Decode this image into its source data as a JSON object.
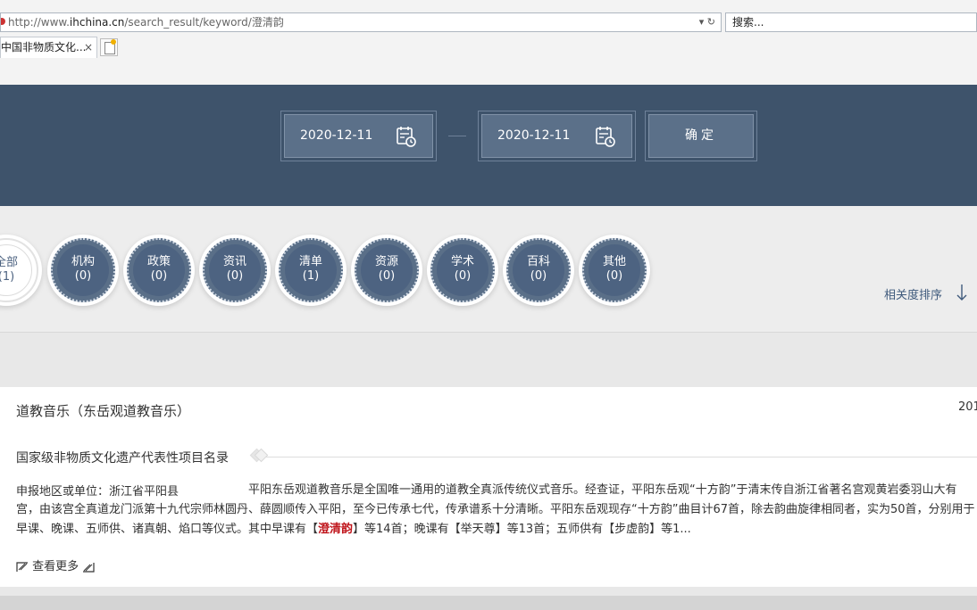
{
  "browser": {
    "url_prefix": "http://www.",
    "url_domain": "ihchina.cn",
    "url_path": "/search_result/keyword/澄清韵",
    "search_placeholder": "搜索...",
    "tab_title": "中国非物质文化...",
    "tab_close": "×",
    "addr_dropdown": "▾",
    "addr_reload": "↻"
  },
  "filter": {
    "start_date": "2020-12-11",
    "end_date": "2020-12-11",
    "confirm_label": "确定"
  },
  "categories": [
    {
      "label": "全部",
      "count": "(1)"
    },
    {
      "label": "机构",
      "count": "(0)"
    },
    {
      "label": "政策",
      "count": "(0)"
    },
    {
      "label": "资讯",
      "count": "(0)"
    },
    {
      "label": "清单",
      "count": "(1)"
    },
    {
      "label": "资源",
      "count": "(0)"
    },
    {
      "label": "学术",
      "count": "(0)"
    },
    {
      "label": "百科",
      "count": "(0)"
    },
    {
      "label": "其他",
      "count": "(0)"
    }
  ],
  "sort_label": "相关度排序",
  "result": {
    "title": "道教音乐（东岳观道教音乐）",
    "date": "201",
    "category": "国家级非物质文化遗产代表性项目名录",
    "region": "申报地区或单位：浙江省平阳县",
    "desc_before": "平阳东岳观道教音乐是全国唯一通用的道教全真派传统仪式音乐。经查证，平阳东岳观“十方韵”于清末传自浙江省著名宫观黄岩委羽山大有宫，由该宫全真道龙门派第十九代宗师林圆丹、薛圆顺传入平阳，至今已传承七代，传承谱系十分清晰。平阳东岳观现存“十方韵”曲目计67首，除去韵曲旋律相同者，实为50首，分别用于早课、晚课、五师供、诸真朝、焰口等仪式。其中早课有【",
    "desc_highlight": "澄清韵",
    "desc_after": "】等14首；晚课有【举天尊】等13首；五师供有【步虚韵】等1...",
    "more_label": "查看更多"
  }
}
